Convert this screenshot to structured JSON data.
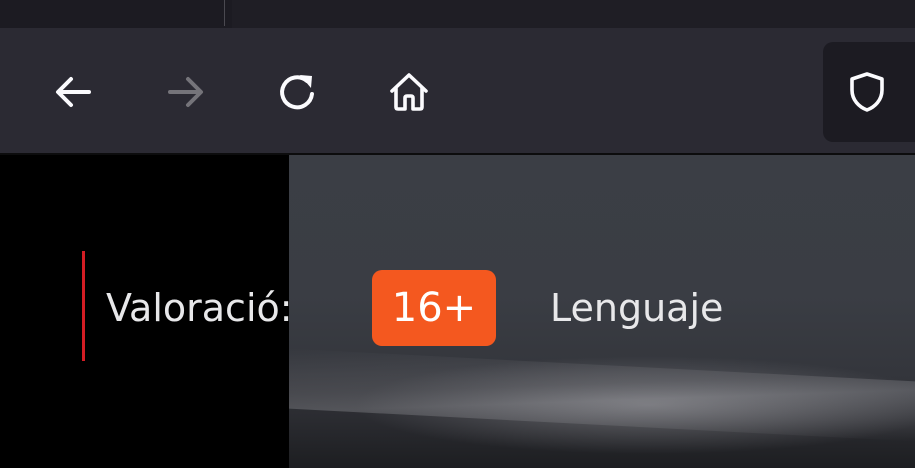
{
  "browser": {
    "toolbar": {
      "back_icon": "arrow-left-icon",
      "forward_icon": "arrow-right-icon",
      "reload_icon": "reload-icon",
      "home_icon": "home-icon",
      "tracking_protection_icon": "shield-icon"
    },
    "colors": {
      "toolbar_bg": "#2b2a33",
      "tabstrip_bg": "#1c1b22",
      "icon_active": "#fbfbfe",
      "icon_disabled": "#75747a"
    }
  },
  "page": {
    "meta": {
      "rating_label": "Valoració:",
      "rating_value": "16+",
      "language_label": "Lenguaje"
    },
    "colors": {
      "accent_bar": "#d41d24",
      "rating_badge": "#f4581f"
    }
  }
}
